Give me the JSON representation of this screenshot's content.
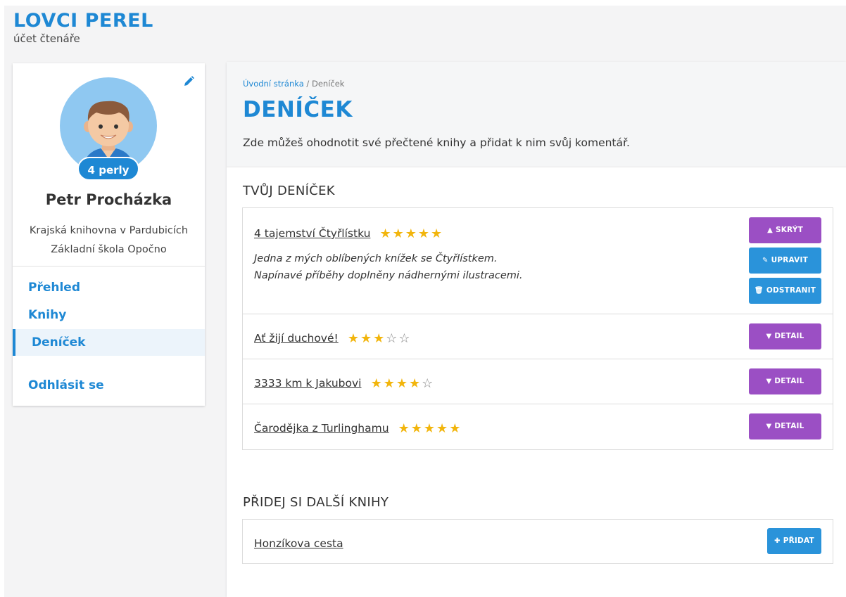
{
  "brand": {
    "title": "LOVCI PEREL",
    "subtitle": "účet čtenáře"
  },
  "profile": {
    "pearls": "4 perly",
    "name": "Petr Procházka",
    "library": "Krajská knihovna v Pardubicích",
    "school": "Základní škola Opočno"
  },
  "nav": {
    "overview": "Přehled",
    "books": "Knihy",
    "diary": "Deníček",
    "logout": "Odhlásit se"
  },
  "breadcrumb": {
    "home": "Úvodní stránka",
    "separator": " / ",
    "current": "Deníček"
  },
  "page": {
    "title": "DENÍČEK",
    "description": "Zde můžeš ohodnotit své přečtené knihy a přidat k nim svůj komentář."
  },
  "diary": {
    "section_title": "TVŮJ DENÍČEK",
    "entries": [
      {
        "title": "4 tajemství Čtyřlístku",
        "rating": 5,
        "comment_line1": "Jedna z mých oblíbených knížek se Čtyřlístkem.",
        "comment_line2": "Napínavé příběhy doplněny nádhernými ilustracemi.",
        "btn_hide": "SKRÝT",
        "btn_edit": "UPRAVIT",
        "btn_delete": "ODSTRANIT"
      },
      {
        "title": "Ať žijí duchové!",
        "rating": 3,
        "btn_detail": "DETAIL"
      },
      {
        "title": "3333 km k Jakubovi",
        "rating": 4,
        "btn_detail": "DETAIL"
      },
      {
        "title": "Čarodějka z Turlinghamu",
        "rating": 5,
        "btn_detail": "DETAIL"
      }
    ]
  },
  "add_books": {
    "section_title": "PŘIDEJ SI DALŠÍ KNIHY",
    "items": [
      {
        "title": "Honzíkova cesta",
        "btn_add": "PŘIDAT"
      }
    ]
  },
  "colors": {
    "brand_blue": "#1e88d4",
    "purple": "#9b4fc4",
    "button_blue": "#2a93da",
    "star": "#f2b50c"
  }
}
